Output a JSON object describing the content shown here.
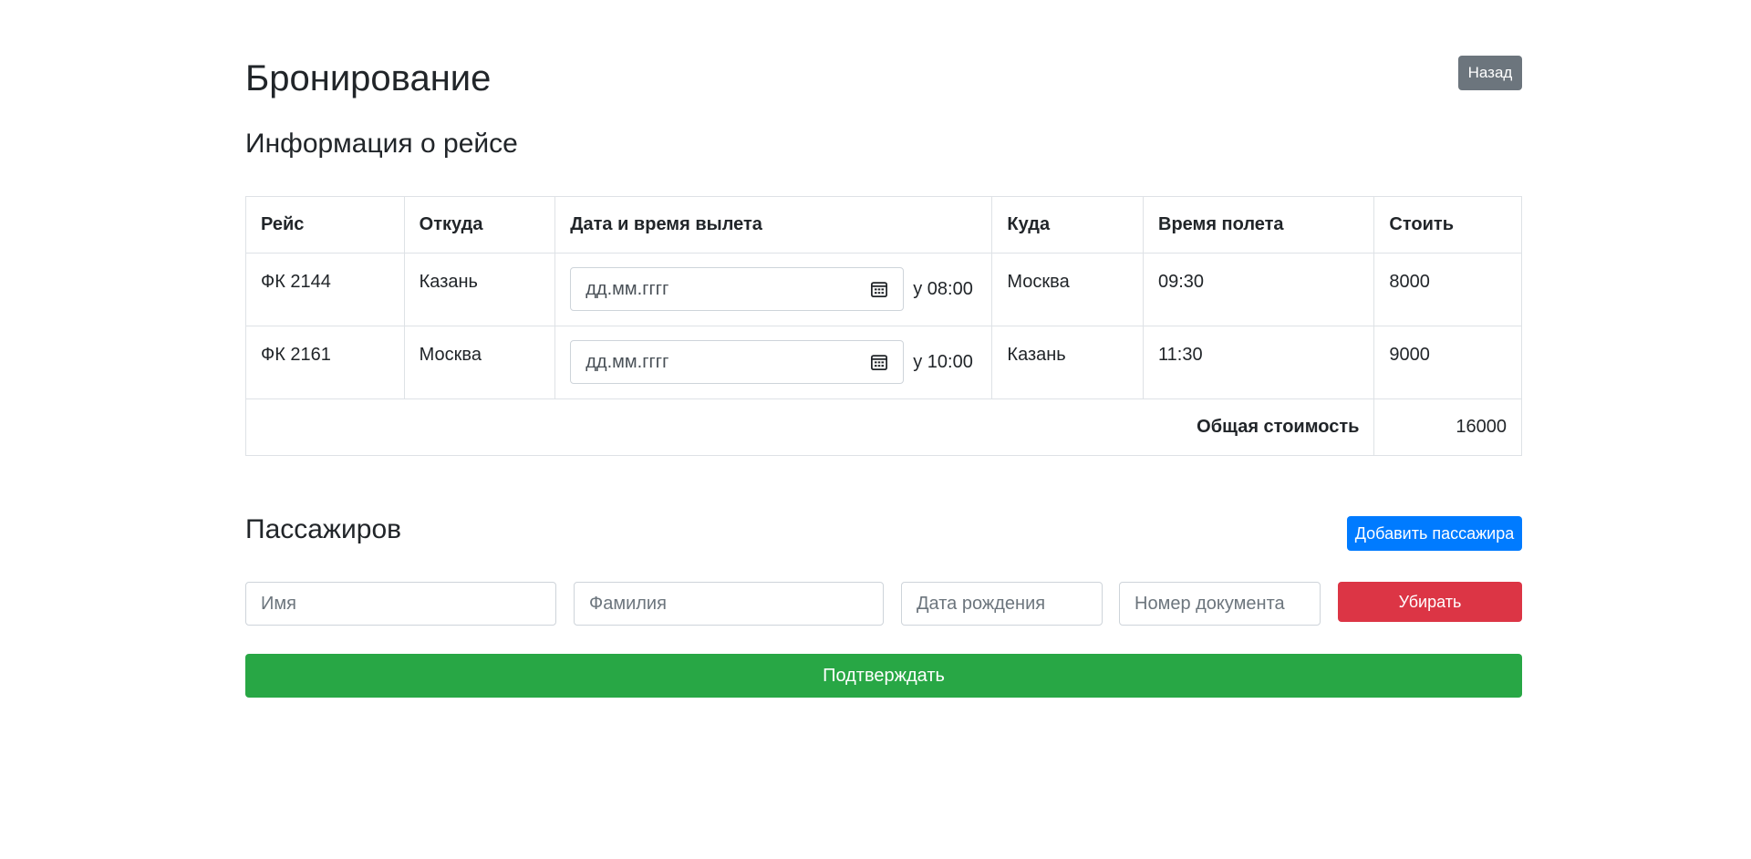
{
  "page": {
    "title": "Бронирование",
    "back_label": "Назад"
  },
  "flight_section": {
    "title": "Информация о рейсе",
    "headers": {
      "flight": "Рейс",
      "from": "Откуда",
      "datetime": "Дата и время вылета",
      "to": "Куда",
      "duration": "Время полета",
      "price": "Стоить"
    },
    "rows": [
      {
        "flight": "ФК 2144",
        "from": "Казань",
        "date_placeholder": "дд.мм.гггг",
        "time": "у 08:00",
        "to": "Москва",
        "duration": "09:30",
        "price": "8000"
      },
      {
        "flight": "ФК 2161",
        "from": "Москва",
        "date_placeholder": "дд.мм.гггг",
        "time": "у 10:00",
        "to": "Казань",
        "duration": "11:30",
        "price": "9000"
      }
    ],
    "total_label": "Общая стоимость",
    "total_value": "16000"
  },
  "passengers": {
    "title": "Пассажиров",
    "add_label": "Добавить пассажира",
    "name_placeholder": "Имя",
    "surname_placeholder": "Фамилия",
    "birthdate_placeholder": "Дата рождения",
    "document_placeholder": "Номер документа",
    "remove_label": "Убирать"
  },
  "confirm_label": "Подтверждать",
  "colors": {
    "secondary": "#6c757d",
    "primary": "#007bff",
    "danger": "#dc3545",
    "success": "#28a745"
  }
}
